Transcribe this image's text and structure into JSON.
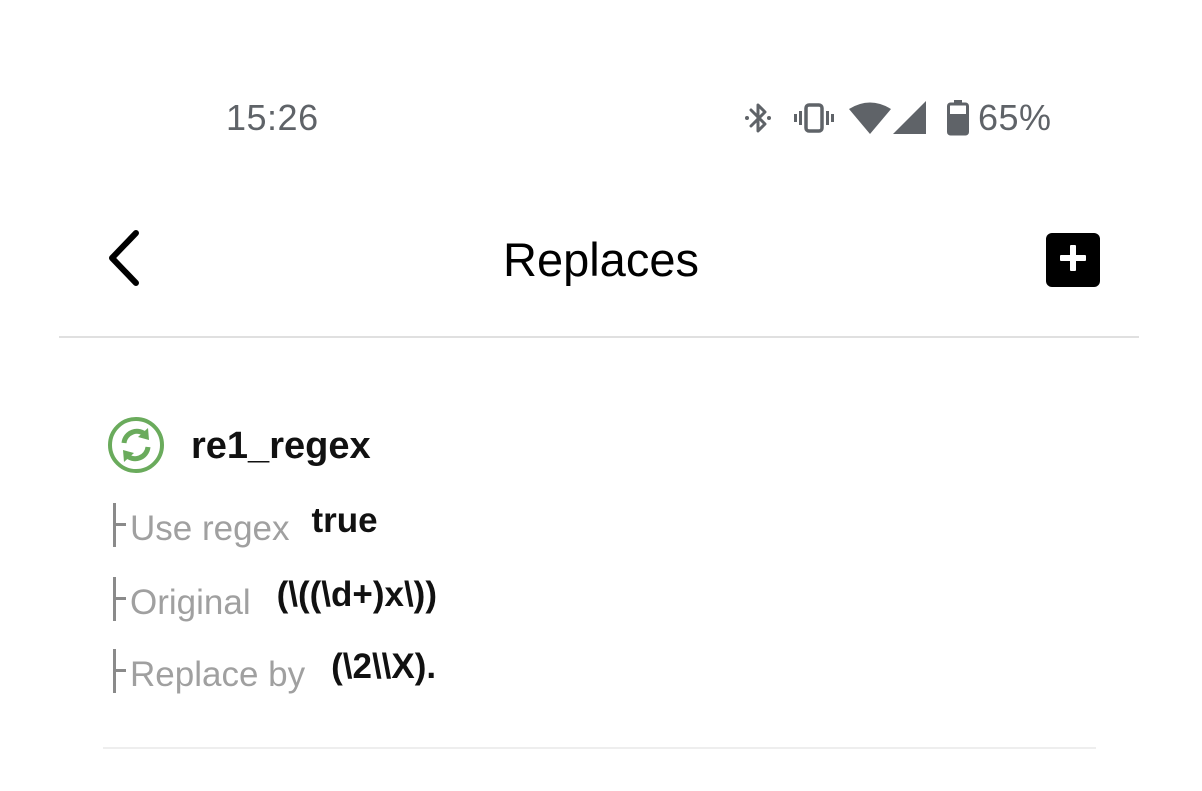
{
  "status_bar": {
    "time": "15:26",
    "icons": [
      "bluetooth-icon",
      "vibrate-icon",
      "wifi-icon",
      "cell-signal-icon",
      "battery-icon"
    ],
    "battery_percent": "65%"
  },
  "app_bar": {
    "title": "Replaces",
    "back_icon": "chevron-left-icon",
    "add_icon": "add-box-icon"
  },
  "replaces": [
    {
      "name": "re1_regex",
      "icon": "sync-icon",
      "icon_color": "#6aab5c",
      "use_regex_label": "Use regex",
      "use_regex_value": "true",
      "original_label": "Original",
      "original_value": "(\\((\\d+)x\\))",
      "replace_by_label": "Replace by",
      "replace_by_value": "(\\2\\\\X)."
    }
  ],
  "colors": {
    "status_text": "#5f6368",
    "label_gray": "#a0a0a0",
    "accent_green": "#6aab5c"
  }
}
